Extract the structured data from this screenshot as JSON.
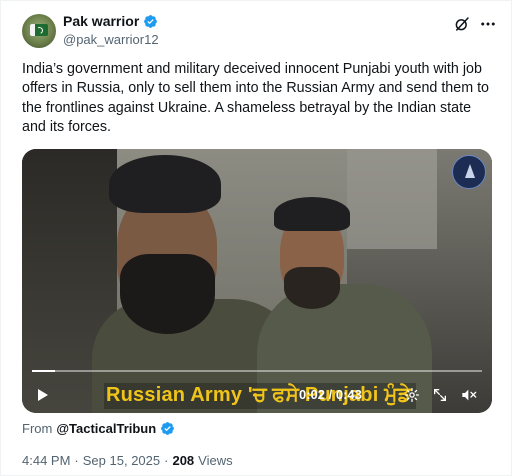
{
  "author": {
    "display_name": "Pak warrior",
    "handle": "@pak_warrior12",
    "verified": true
  },
  "tweet": {
    "text": "India’s government and military deceived innocent Punjabi youth with job offers in Russia, only to sell them into the Russian Army and send them to the frontlines against Ukraine. A shameless betrayal by the Indian state and its forces."
  },
  "video": {
    "caption_overlay": "Russian Army 'ਚ ਫਸੇ Punjabi ਮੁੰਡੇ",
    "time_display": "0:02 / 0:43",
    "progress_fraction": 0.05
  },
  "attribution": {
    "from_label": "From",
    "source_name": "@TacticalTribun",
    "source_verified": true
  },
  "meta": {
    "time": "4:44 PM",
    "separator1": "·",
    "date": "Sep 15, 2025",
    "separator2": "·",
    "views_count": "208",
    "views_label": "Views"
  },
  "colors": {
    "verified_blue": "#1d9bf0",
    "text_primary": "#0f1419",
    "text_secondary": "#536471",
    "caption_yellow": "#f0c419"
  },
  "icons": {
    "verified": "verified-badge-icon",
    "grok": "grok-icon",
    "more": "more-options-icon",
    "play": "play-icon",
    "settings": "settings-icon",
    "expand": "expand-icon",
    "volume": "volume-icon"
  }
}
